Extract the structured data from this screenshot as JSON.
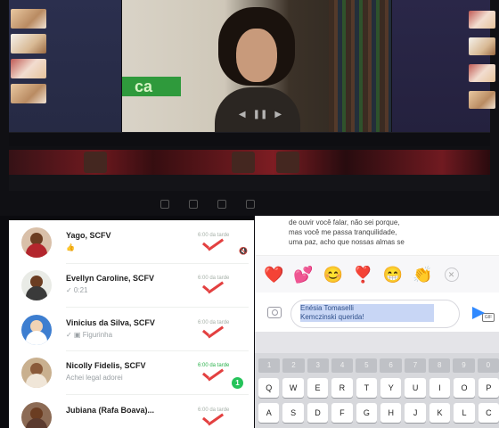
{
  "chats": [
    {
      "name": "Yago, SCFV",
      "preview": "👍",
      "time": "6:00 da tarde",
      "status": "muted"
    },
    {
      "name": "Evellyn Caroline, SCFV",
      "preview": "✓ 0:21",
      "time": "6:00 da tarde",
      "status": "read"
    },
    {
      "name": "Vinicius da Silva, SCFV",
      "preview": "✓ ▣ Figurinha",
      "time": "6:00 da tarde",
      "status": "read"
    },
    {
      "name": "Nicolly Fidelis, SCFV",
      "preview": "Achei legal adorei",
      "time": "6:00 da tarde",
      "status": "unread",
      "unread_count": "1"
    },
    {
      "name": "Jubiana (Rafa Boava)...",
      "preview": "",
      "time": "6:00 da tarde",
      "status": "read"
    }
  ],
  "message_bubble": [
    "de ouvir você falar, não sei porque,",
    "mas você me passa tranquilidade,",
    "uma paz, acho que nossas almas se"
  ],
  "reactions": [
    "❤️",
    "💕",
    "😊",
    "❣️",
    "😁",
    "👏"
  ],
  "input": {
    "value_line1": "Enésia Tomaselli",
    "value_line2": "Kemczinski querida!"
  },
  "keyboard": {
    "numbers": [
      "1",
      "2",
      "3",
      "4",
      "5",
      "6",
      "7",
      "8",
      "9",
      "0"
    ],
    "row1": [
      "Q",
      "W",
      "E",
      "R",
      "T",
      "Y",
      "U",
      "I",
      "O",
      "P"
    ],
    "row2": [
      "A",
      "S",
      "D",
      "F",
      "G",
      "H",
      "J",
      "K",
      "L",
      "C"
    ]
  },
  "video": {
    "sign_text": "ca"
  },
  "colors": {
    "tick_red": "#e34040",
    "send_blue": "#2f89ff",
    "unread_green": "#25c35a"
  }
}
